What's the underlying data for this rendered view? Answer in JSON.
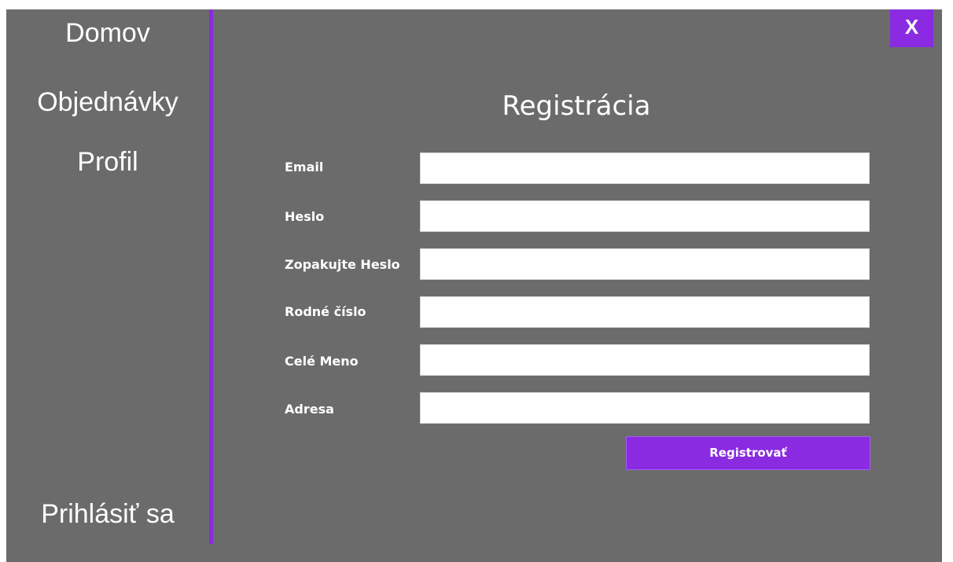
{
  "sidebar": {
    "items": [
      {
        "label": "Domov"
      },
      {
        "label": "Objednávky"
      },
      {
        "label": "Profil"
      }
    ],
    "login_label": "Prihlásiť sa"
  },
  "window": {
    "close_label": "X"
  },
  "form": {
    "title": "Registrácia",
    "fields": [
      {
        "label": "Email",
        "value": ""
      },
      {
        "label": "Heslo",
        "value": ""
      },
      {
        "label": "Zopakujte Heslo",
        "value": ""
      },
      {
        "label": "Rodné číslo",
        "value": ""
      },
      {
        "label": "Celé Meno",
        "value": ""
      },
      {
        "label": "Adresa",
        "value": ""
      }
    ],
    "submit_label": "Registrovať"
  },
  "colors": {
    "background": "#6b6b6b",
    "accent": "#8a2be2",
    "text": "#ffffff",
    "input_background": "#ffffff"
  }
}
